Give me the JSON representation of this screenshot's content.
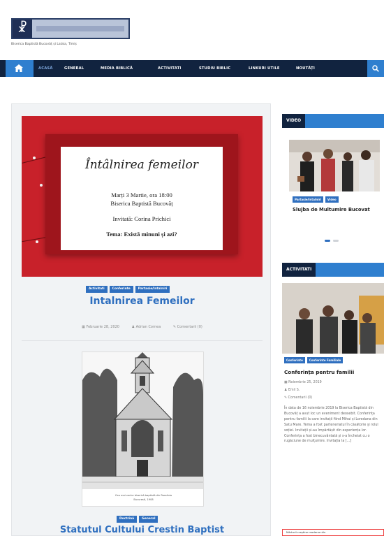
{
  "site": {
    "tagline": "Biserica Baptistă Bucovăț și Lalaia, Timiș"
  },
  "nav": {
    "items": [
      {
        "label": "ACASĂ"
      },
      {
        "label": "GENERAL"
      },
      {
        "label": "MEDIA BIBLICĂ"
      },
      {
        "label": "ACTIVITATI"
      },
      {
        "label": "STUDIU BIBLIC"
      },
      {
        "label": "LINKURI UTILE"
      },
      {
        "label": "NOUTĂȚI"
      }
    ]
  },
  "posts": [
    {
      "title": "Intalnirea Femeilor",
      "tags": [
        "Activitati",
        "Conferinte",
        "Partasie/Intalniri"
      ],
      "image_card": {
        "title": "Întâlnirea femeilor",
        "line1": "Marți 3 Martie, ora 18:00",
        "line2": "Biserica Baptistă Bucovăț",
        "line3": "Invitată: Corina Prichici",
        "line4": "Tema: Există minuni și azi?"
      },
      "meta": {
        "date": "Februarie 28, 2020",
        "author": "Adrian Cornea",
        "comments": "Comentarii (0)"
      }
    },
    {
      "title": "Statutul Cultului Crestin Baptist",
      "tags": [
        "Doctrină",
        "General"
      ],
      "image_caption_line1": "Cea mai veche biserică baptistă din România",
      "image_caption_line2": "Bucuresti, 1908"
    }
  ],
  "sidebar": {
    "video": {
      "heading": "VIDEO",
      "tags": [
        "Partasie/Intalniri",
        "Video"
      ],
      "title": "Slujba de Multumire Bucovat"
    },
    "activitati": {
      "heading": "ACTIVITATI",
      "tags": [
        "Conferinte",
        "Conferinte Familiale"
      ],
      "title": "Conferința pentru familii",
      "date": "Noiembrie 25, 2019",
      "author": "Emil S.",
      "comments": "Comentarii (0)",
      "excerpt": "În data de 16 noiembrie 2019 la Biserica Baptistă din Bucovăț a avut loc un eveniment deosebit. Conferința pentru familii la care invitații fiind Mihai și Loredana din Satu Mare. Tema a fost parteneriatul în căsătorie și rolul soției. Invitații și-au împărtășit din experiența lor. Conferința a fost binecuvântată și s-a încheiat cu o rugăciune de mulțumire. Invitația la [...]"
    },
    "bottom_box": "Mărturii creștine moderne din"
  },
  "colors": {
    "nav_bg": "#11233f",
    "accent_blue": "#2f7fcf",
    "title_blue": "#2f6fbf",
    "poster_red": "#c8212a"
  }
}
